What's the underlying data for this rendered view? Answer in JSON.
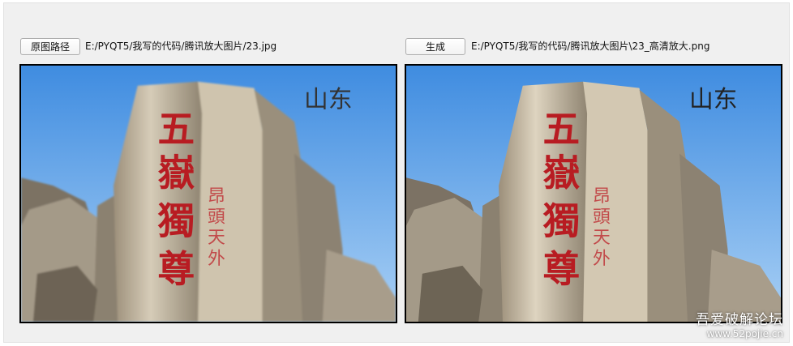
{
  "left": {
    "button_label": "原图路径",
    "path_text": "E:/PYQT5/我写的代码/腾讯放大图片/23.jpg"
  },
  "right": {
    "button_label": "生成",
    "path_text": "E:/PYQT5/我写的代码/腾讯放大图片\\23_高清放大.png"
  },
  "image": {
    "corner_text": "山东",
    "main_inscription": [
      "五",
      "嶽",
      "獨",
      "尊"
    ],
    "side_inscription": [
      "昂",
      "頭",
      "天",
      "外"
    ]
  },
  "watermark": {
    "site_cn": "吾爱破解论坛",
    "site_url": "www.52pojie.cn"
  },
  "colors": {
    "sky_top": "#3f8ce0",
    "sky_bottom": "#a9d0f5",
    "rock": "#c8bca6",
    "inscription_red": "#b81c22"
  }
}
